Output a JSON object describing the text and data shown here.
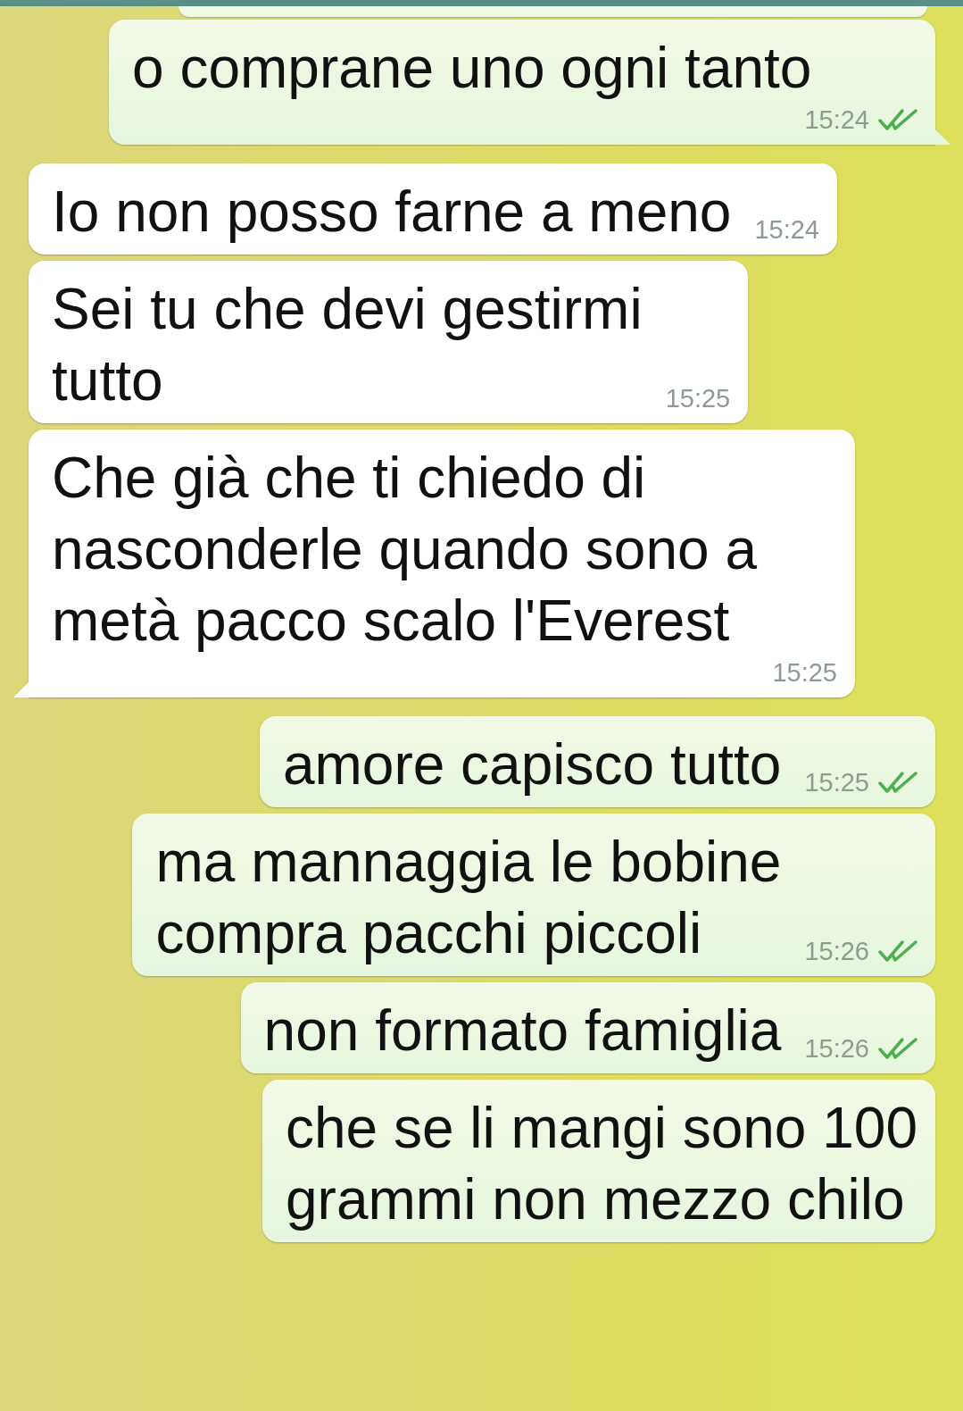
{
  "messages": [
    {
      "kind": "out",
      "text": "o comprane uno ogni tanto",
      "time": "15:24",
      "read": true,
      "tail": true
    },
    {
      "kind": "in",
      "text": "Io non posso farne a meno",
      "time": "15:24",
      "tail": false
    },
    {
      "kind": "in",
      "text": "Sei tu che devi gestirmi\ntutto",
      "time": "15:25",
      "tail": false
    },
    {
      "kind": "in",
      "text": "Che già che ti chiedo di\nnasconderle quando sono a\nmetà pacco scalo l'Everest",
      "time": "15:25",
      "tail": true
    },
    {
      "kind": "out",
      "text": "amore capisco tutto",
      "time": "15:25",
      "read": true,
      "tail": false
    },
    {
      "kind": "out",
      "text": "ma mannaggia le bobine\ncompra pacchi piccoli",
      "time": "15:26",
      "read": true,
      "tail": false
    },
    {
      "kind": "out",
      "text": "non formato famiglia",
      "time": "15:26",
      "read": true,
      "tail": false
    },
    {
      "kind": "out",
      "text": "che se li mangi sono 100\ngrammi non mezzo chilo",
      "tail": false
    }
  ]
}
